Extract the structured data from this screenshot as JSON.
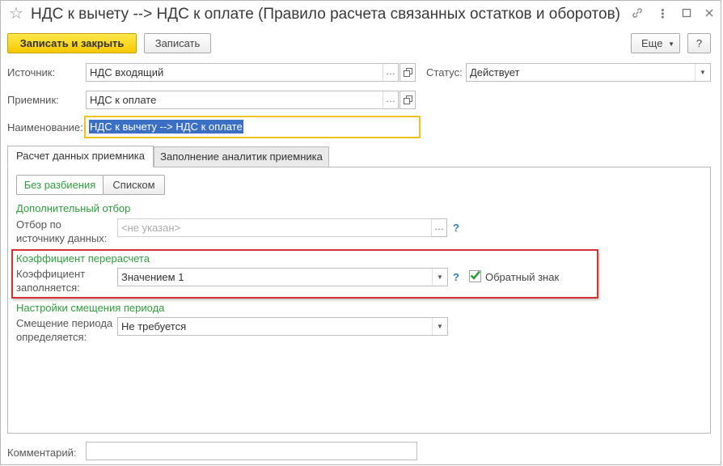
{
  "window": {
    "title": "НДС к вычету --> НДС к оплате (Правило расчета связанных остатков и оборотов)",
    "icons": [
      "star-icon",
      "link-icon",
      "more-icon",
      "maximize-icon",
      "close-icon"
    ]
  },
  "toolbar": {
    "save_close_label": "Записать и закрыть",
    "save_label": "Записать",
    "more_label": "Еще",
    "help_label": "?"
  },
  "form": {
    "source_label": "Источник:",
    "source_value": "НДС входящий",
    "status_label": "Статус:",
    "status_value": "Действует",
    "receiver_label": "Приемник:",
    "receiver_value": "НДС к оплате",
    "name_label": "Наименование:",
    "name_value": "НДС к вычету --> НДС к оплате"
  },
  "tabs": [
    {
      "label": "Расчет данных приемника",
      "active": true
    },
    {
      "label": "Заполнение аналитик приемника",
      "active": false
    }
  ],
  "mode_buttons": [
    {
      "label": "Без разбиения",
      "active": true
    },
    {
      "label": "Списком",
      "active": false
    }
  ],
  "sections": {
    "extra_filter": {
      "header": "Дополнительный отбор",
      "filter_label_1": "Отбор по",
      "filter_label_2": "источнику данных:",
      "filter_placeholder": "<не указан>",
      "help": "?"
    },
    "coefficient": {
      "header": "Коэффициент перерасчета",
      "label_1": "Коэффициент",
      "label_2": "заполняется:",
      "value": "Значением 1",
      "help": "?",
      "reverse_sign_label": "Обратный знак",
      "reverse_sign_checked": true
    },
    "period_shift": {
      "header": "Настройки смещения периода",
      "label_1": "Смещение периода",
      "label_2": "определяется:",
      "value": "Не требуется"
    }
  },
  "comment": {
    "label": "Комментарий:",
    "value": ""
  },
  "colors": {
    "primary_button": "#f6c800",
    "section_header": "#2e9e3c",
    "highlight_frame": "#d93030",
    "focus_border": "#f0c21c",
    "selection": "#3a6fc4"
  }
}
